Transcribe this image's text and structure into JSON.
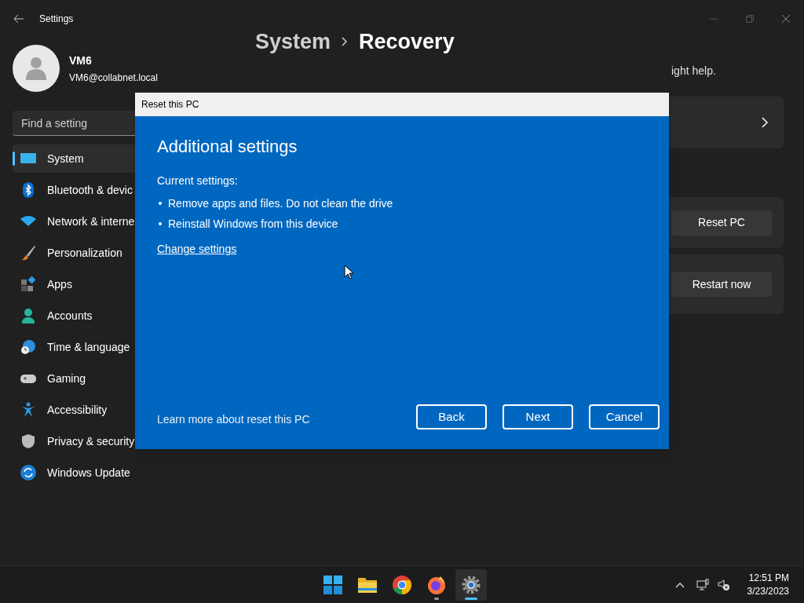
{
  "window": {
    "title": "Settings"
  },
  "profile": {
    "name": "VM6",
    "email": "VM6@collabnet.local"
  },
  "search": {
    "placeholder": "Find a setting"
  },
  "sidebar": {
    "items": [
      {
        "label": "System",
        "kind": "system",
        "selected": true
      },
      {
        "label": "Bluetooth & devic",
        "kind": "bluetooth",
        "selected": false
      },
      {
        "label": "Network & interne",
        "kind": "network",
        "selected": false
      },
      {
        "label": "Personalization",
        "kind": "brush",
        "selected": false
      },
      {
        "label": "Apps",
        "kind": "apps",
        "selected": false
      },
      {
        "label": "Accounts",
        "kind": "accounts",
        "selected": false
      },
      {
        "label": "Time & language",
        "kind": "time",
        "selected": false
      },
      {
        "label": "Gaming",
        "kind": "gaming",
        "selected": false
      },
      {
        "label": "Accessibility",
        "kind": "accessibility",
        "selected": false
      },
      {
        "label": "Privacy & security",
        "kind": "privacy",
        "selected": false
      },
      {
        "label": "Windows Update",
        "kind": "update",
        "selected": false
      }
    ]
  },
  "breadcrumb": {
    "parent": "System",
    "current": "Recovery"
  },
  "description": "ight help.",
  "cards": [
    {
      "kind": "chevron"
    },
    {
      "kind": "button",
      "button": "Reset PC"
    },
    {
      "kind": "button",
      "button": "Restart now"
    }
  ],
  "dialog": {
    "title": "Reset this PC",
    "heading": "Additional settings",
    "subheading": "Current settings:",
    "bullets": [
      "Remove apps and files. Do not clean the drive",
      "Reinstall Windows from this device"
    ],
    "link": "Change settings",
    "learn_more": "Learn more about reset this PC",
    "buttons": [
      "Back",
      "Next",
      "Cancel"
    ]
  },
  "taskbar": {
    "apps": [
      {
        "kind": "start",
        "running": false,
        "selected": false
      },
      {
        "kind": "folder",
        "running": false,
        "selected": false
      },
      {
        "kind": "chrome",
        "running": false,
        "selected": false
      },
      {
        "kind": "firefox",
        "running": true,
        "selected": false
      },
      {
        "kind": "settings",
        "running": true,
        "selected": true
      }
    ],
    "time": "12:51 PM",
    "date": "3/23/2023"
  }
}
